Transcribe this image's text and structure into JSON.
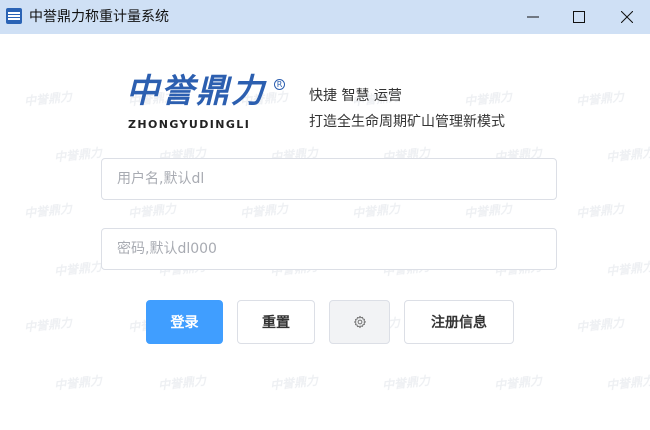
{
  "window": {
    "title": "中誉鼎力称重计量系统",
    "icon": "app-logo-icon",
    "controls": [
      "minimize-icon",
      "maximize-icon",
      "close-icon"
    ]
  },
  "logo": {
    "brand_text": "中誉鼎力",
    "brand_pinyin": "ZHONGYUDINGLI",
    "registered_mark": "R",
    "tagline_primary": "快捷 智慧 运营",
    "tagline_secondary": "打造全生命周期矿山管理新模式"
  },
  "watermark_text": "中誉鼎力",
  "form": {
    "username_placeholder": "用户名,默认dl",
    "username_value": "",
    "password_placeholder": "密码,默认dl000",
    "password_value": ""
  },
  "actions": {
    "login_label": "登录",
    "reset_label": "重置",
    "settings_icon": "gear-icon",
    "register_info_label": "注册信息"
  },
  "colors": {
    "title_bar": "#cfe0f5",
    "primary_button": "#409eff",
    "brand_blue": "#2c5fb0"
  }
}
